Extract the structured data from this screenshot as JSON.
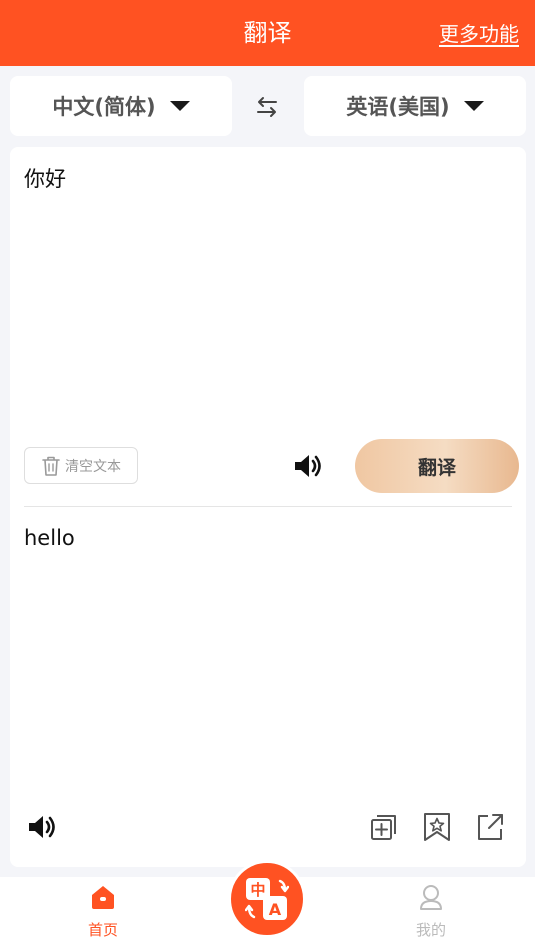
{
  "header": {
    "title": "翻译",
    "more_label": "更多功能"
  },
  "languages": {
    "source": "中文(简体)",
    "target": "英语(美国)"
  },
  "source_panel": {
    "text": "你好",
    "clear_label": "清空文本",
    "translate_label": "翻译"
  },
  "result_panel": {
    "text": "hello"
  },
  "tabbar": {
    "home_label": "首页",
    "mine_label": "我的",
    "fab_glyph_top": "中",
    "fab_glyph_bottom": "A"
  },
  "icons": {
    "caret": "caret-down-icon",
    "swap": "swap-arrows-icon",
    "trash": "trash-icon",
    "speaker": "speaker-icon",
    "copy": "copy-add-icon",
    "favorite": "bookmark-star-icon",
    "share": "share-icon",
    "home": "home-icon",
    "user": "user-icon"
  },
  "colors": {
    "brand": "#ff5222",
    "button_gradient_start": "#f0c7a2",
    "button_gradient_end": "#e8b88f",
    "inactive": "#bbbbbb"
  }
}
